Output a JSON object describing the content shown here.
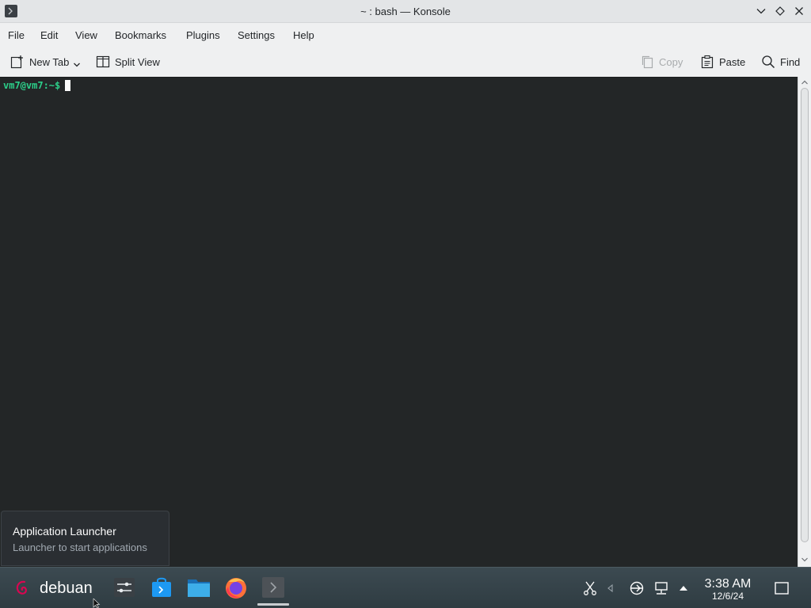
{
  "window": {
    "title": "~ : bash — Konsole"
  },
  "menubar": {
    "items": [
      "File",
      "Edit",
      "View",
      "Bookmarks",
      "Plugins",
      "Settings",
      "Help"
    ]
  },
  "toolbar": {
    "new_tab": "New Tab",
    "split_view": "Split View",
    "copy": "Copy",
    "paste": "Paste",
    "find": "Find"
  },
  "terminal": {
    "prompt": "vm7@vm7:~$"
  },
  "tooltip": {
    "title": "Application Launcher",
    "subtitle": "Launcher to start applications"
  },
  "taskbar": {
    "launcher_label": "debuan",
    "tasks": [
      "system-settings-icon",
      "discover-store-icon",
      "file-manager-icon",
      "firefox-icon",
      "konsole-icon"
    ],
    "tray": [
      "scissors-icon",
      "volume-icon",
      "network-vpn-icon",
      "display-network-icon",
      "tray-expand-arrow-icon"
    ],
    "clock_time": "3:38 AM",
    "clock_date": "12/6/24"
  },
  "colors": {
    "terminal_bg": "#232627",
    "prompt": "#2ccf8a",
    "taskbar_bg": "#34424a",
    "debian_red": "#d70751"
  }
}
